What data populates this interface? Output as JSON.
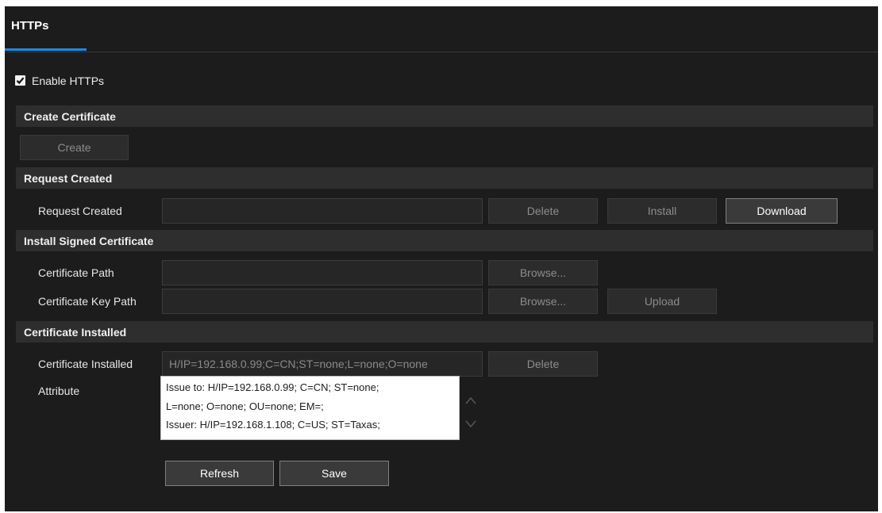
{
  "tab": {
    "label": "HTTPs"
  },
  "enable": {
    "label": "Enable HTTPs",
    "checked": true
  },
  "sections": {
    "create": "Create Certificate",
    "request": "Request Created",
    "install": "Install Signed Certificate",
    "installed": "Certificate Installed"
  },
  "create": {
    "button": "Create"
  },
  "request": {
    "label": "Request Created",
    "value": "",
    "delete_button": "Delete",
    "install_button": "Install",
    "download_button": "Download"
  },
  "install": {
    "cert_path_label": "Certificate Path",
    "cert_path_value": "",
    "browse_button_1": "Browse...",
    "key_path_label": "Certificate Key Path",
    "key_path_value": "",
    "browse_button_2": "Browse...",
    "upload_button": "Upload"
  },
  "installed": {
    "label": "Certificate Installed",
    "value": "H/IP=192.168.0.99;C=CN;ST=none;L=none;O=none",
    "delete_button": "Delete",
    "attribute_label": "Attribute",
    "attribute_lines": [
      "Issue to: H/IP=192.168.0.99; C=CN; ST=none;",
      "L=none; O=none; OU=none; EM=;",
      "Issuer: H/IP=192.168.1.108; C=US; ST=Taxas;"
    ]
  },
  "actions": {
    "refresh_button": "Refresh",
    "save_button": "Save"
  },
  "colors": {
    "accent": "#1e88e5",
    "background": "#1c1c1c",
    "section_bar": "#2e2e2e"
  }
}
